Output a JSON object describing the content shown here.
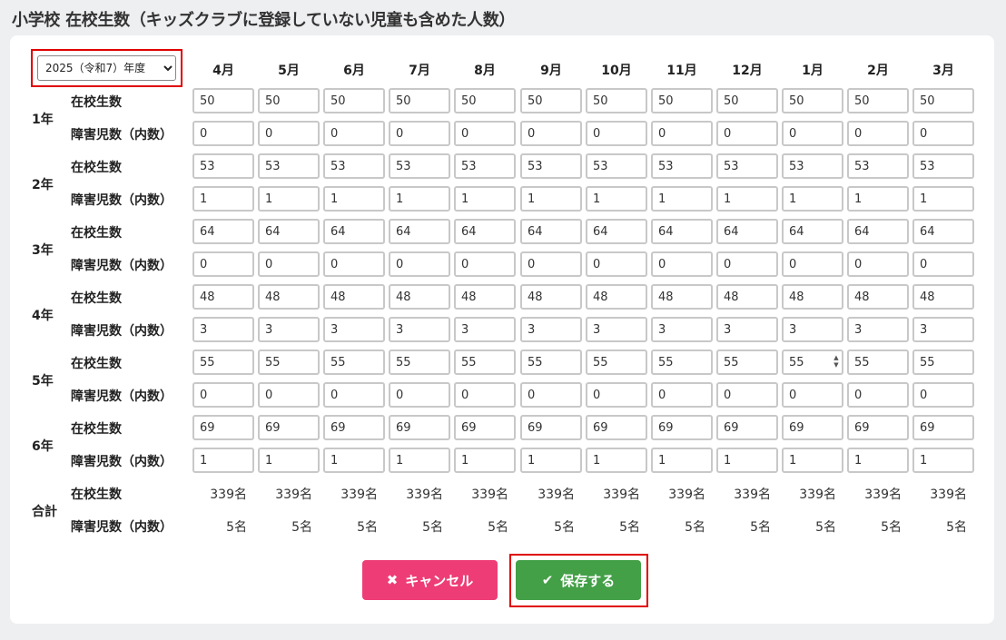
{
  "page": {
    "title": "小学校 在校生数（キッズクラブに登録していない児童も含めた人数）"
  },
  "year_select": {
    "value": "2025（令和7）年度",
    "options": [
      "2025（令和7）年度"
    ]
  },
  "months": [
    "4月",
    "5月",
    "6月",
    "7月",
    "8月",
    "9月",
    "10月",
    "11月",
    "12月",
    "1月",
    "2月",
    "3月"
  ],
  "row_labels": {
    "enrolled": "在校生数",
    "disabled": "障害児数（内数）"
  },
  "grades": [
    {
      "label": "1年",
      "enrolled": [
        "50",
        "50",
        "50",
        "50",
        "50",
        "50",
        "50",
        "50",
        "50",
        "50",
        "50",
        "50"
      ],
      "disabled": [
        "0",
        "0",
        "0",
        "0",
        "0",
        "0",
        "0",
        "0",
        "0",
        "0",
        "0",
        "0"
      ]
    },
    {
      "label": "2年",
      "enrolled": [
        "53",
        "53",
        "53",
        "53",
        "53",
        "53",
        "53",
        "53",
        "53",
        "53",
        "53",
        "53"
      ],
      "disabled": [
        "1",
        "1",
        "1",
        "1",
        "1",
        "1",
        "1",
        "1",
        "1",
        "1",
        "1",
        "1"
      ]
    },
    {
      "label": "3年",
      "enrolled": [
        "64",
        "64",
        "64",
        "64",
        "64",
        "64",
        "64",
        "64",
        "64",
        "64",
        "64",
        "64"
      ],
      "disabled": [
        "0",
        "0",
        "0",
        "0",
        "0",
        "0",
        "0",
        "0",
        "0",
        "0",
        "0",
        "0"
      ]
    },
    {
      "label": "4年",
      "enrolled": [
        "48",
        "48",
        "48",
        "48",
        "48",
        "48",
        "48",
        "48",
        "48",
        "48",
        "48",
        "48"
      ],
      "disabled": [
        "3",
        "3",
        "3",
        "3",
        "3",
        "3",
        "3",
        "3",
        "3",
        "3",
        "3",
        "3"
      ]
    },
    {
      "label": "5年",
      "enrolled": [
        "55",
        "55",
        "55",
        "55",
        "55",
        "55",
        "55",
        "55",
        "55",
        "55",
        "55",
        "55"
      ],
      "disabled": [
        "0",
        "0",
        "0",
        "0",
        "0",
        "0",
        "0",
        "0",
        "0",
        "0",
        "0",
        "0"
      ]
    },
    {
      "label": "6年",
      "enrolled": [
        "69",
        "69",
        "69",
        "69",
        "69",
        "69",
        "69",
        "69",
        "69",
        "69",
        "69",
        "69"
      ],
      "disabled": [
        "1",
        "1",
        "1",
        "1",
        "1",
        "1",
        "1",
        "1",
        "1",
        "1",
        "1",
        "1"
      ]
    }
  ],
  "totals": {
    "label": "合計",
    "enrolled": [
      "339名",
      "339名",
      "339名",
      "339名",
      "339名",
      "339名",
      "339名",
      "339名",
      "339名",
      "339名",
      "339名",
      "339名"
    ],
    "disabled": [
      "5名",
      "5名",
      "5名",
      "5名",
      "5名",
      "5名",
      "5名",
      "5名",
      "5名",
      "5名",
      "5名",
      "5名"
    ]
  },
  "buttons": {
    "cancel_label": "キャンセル",
    "cancel_icon": "close-icon",
    "save_label": "保存する",
    "save_icon": "check-icon"
  },
  "colors": {
    "cancel": "#ee3d76",
    "save": "#43a047",
    "highlight": "#e00000"
  }
}
